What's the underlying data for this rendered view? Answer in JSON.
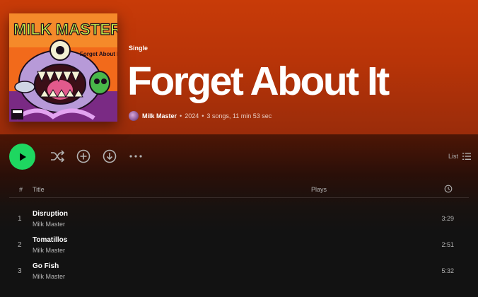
{
  "album": {
    "type_label": "Single",
    "title": "Forget About It",
    "artist": "Milk Master",
    "year": "2024",
    "summary": "3 songs, 11 min 53 sec",
    "cover_text": "MILK MASTER",
    "cover_subtext": "Forget About It"
  },
  "actions": {
    "play_icon": "play-icon",
    "shuffle_icon": "shuffle-icon",
    "add_icon": "add-circle-icon",
    "download_icon": "download-icon",
    "more_icon": "more-options-icon",
    "list_label": "List",
    "list_icon": "list-view-icon"
  },
  "table": {
    "headers": {
      "number": "#",
      "title": "Title",
      "plays": "Plays",
      "duration_icon": "clock-icon"
    },
    "tracks": [
      {
        "number": "1",
        "title": "Disruption",
        "artist": "Milk Master",
        "duration": "3:29"
      },
      {
        "number": "2",
        "title": "Tomatillos",
        "artist": "Milk Master",
        "duration": "2:51"
      },
      {
        "number": "3",
        "title": "Go Fish",
        "artist": "Milk Master",
        "duration": "5:32"
      }
    ]
  },
  "colors": {
    "header_bg": "#c83b08",
    "play_green": "#1ed760",
    "page_bg": "#121212"
  }
}
